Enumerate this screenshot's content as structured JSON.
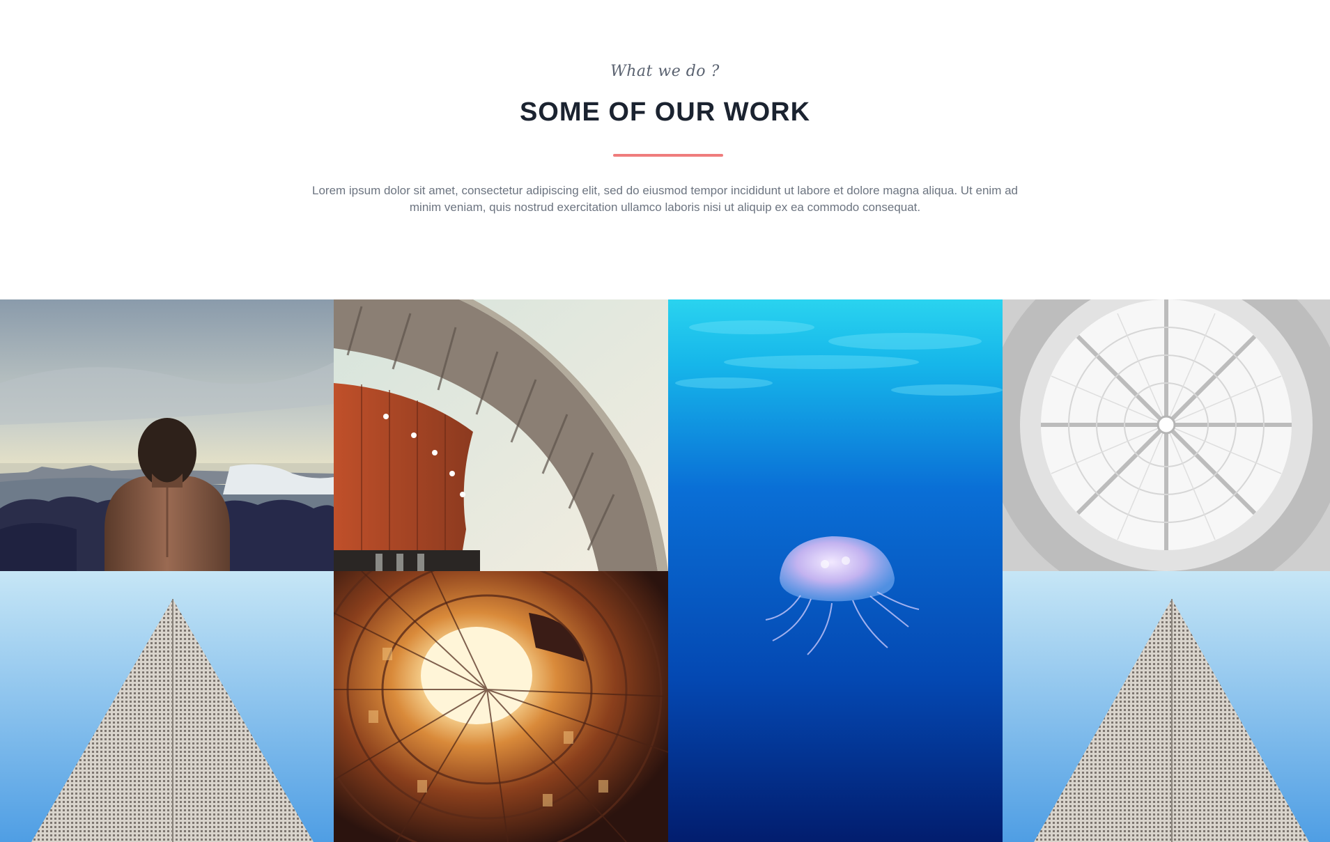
{
  "section": {
    "kicker": "What we do ?",
    "title": "SOME OF OUR WORK",
    "intro": "Lorem ipsum dolor sit amet, consectetur adipiscing elit, sed do eiusmod tempor incididunt ut labore et dolore magna aliqua. Ut enim ad minim veniam, quis nostrud exercitation ullamco laboris nisi ut aliquip ex ea commodo consequat.",
    "accent_color": "#ef7c7c"
  },
  "gallery": {
    "items": [
      {
        "name": "man-at-sea-photo"
      },
      {
        "name": "curved-building-photo"
      },
      {
        "name": "jellyfish-photo"
      },
      {
        "name": "glass-dome-photo"
      },
      {
        "name": "skyscraper-photo"
      },
      {
        "name": "courtyard-sky-photo"
      },
      {
        "name": "skyscraper-photo"
      }
    ]
  }
}
